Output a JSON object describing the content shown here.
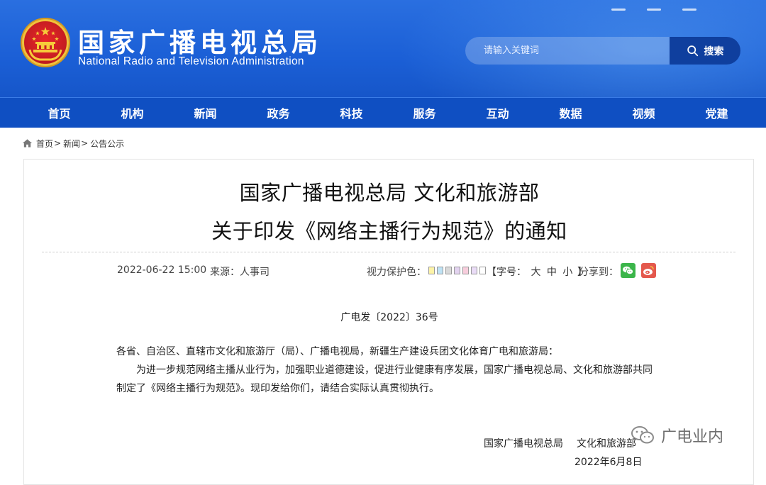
{
  "header": {
    "title": "国家广播电视总局",
    "subtitle": "National Radio and Television Administration",
    "search": {
      "placeholder": "请输入关键词",
      "button_label": "搜索"
    }
  },
  "nav": {
    "items": [
      {
        "label": "首页"
      },
      {
        "label": "机构"
      },
      {
        "label": "新闻"
      },
      {
        "label": "政务"
      },
      {
        "label": "科技"
      },
      {
        "label": "服务"
      },
      {
        "label": "互动"
      },
      {
        "label": "数据"
      },
      {
        "label": "视频"
      },
      {
        "label": "党建"
      }
    ]
  },
  "breadcrumb": {
    "items": [
      {
        "label": "首页"
      },
      {
        "label": "新闻"
      },
      {
        "label": "公告公示"
      }
    ],
    "separator": ">"
  },
  "article": {
    "title_line1": "国家广播电视总局 文化和旅游部",
    "title_line2": "关于印发《网络主播行为规范》的通知",
    "datetime": "2022-06-22 15:00",
    "source": "来源：人事司",
    "eye_care_label": "视力保护色：",
    "eye_care_colors": [
      "#fdf3a7",
      "#bfe3f5",
      "#d9d9d9",
      "#e3d3f0",
      "#f7cddc",
      "#eadcf7",
      "#ffffff"
    ],
    "font_size_open": "【字号：",
    "font_size_options": [
      "大",
      "中",
      "小"
    ],
    "font_size_close": "】",
    "share_label": "分享到：",
    "share_icons": [
      "wechat-icon",
      "weibo-icon"
    ],
    "doc_number": "广电发〔2022〕36号",
    "paragraph1": "各省、自治区、直辖市文化和旅游厅（局）、广播电视局，新疆生产建设兵团文化体育广电和旅游局：",
    "paragraph2": "为进一步规范网络主播从业行为，加强职业道德建设，促进行业健康有序发展，国家广播电视总局、文化和旅游部共同制定了《网络主播行为规范》。现印发给你们，请结合实际认真贯彻执行。",
    "signer1": "国家广播电视总局",
    "signer2": "文化和旅游部",
    "sign_date": "2022年6月8日"
  },
  "watermark": {
    "text": "广电业内"
  },
  "colors": {
    "header_blue": "#1b5fd6",
    "nav_blue": "#0f4fc2",
    "search_button": "#0f3f9e"
  }
}
